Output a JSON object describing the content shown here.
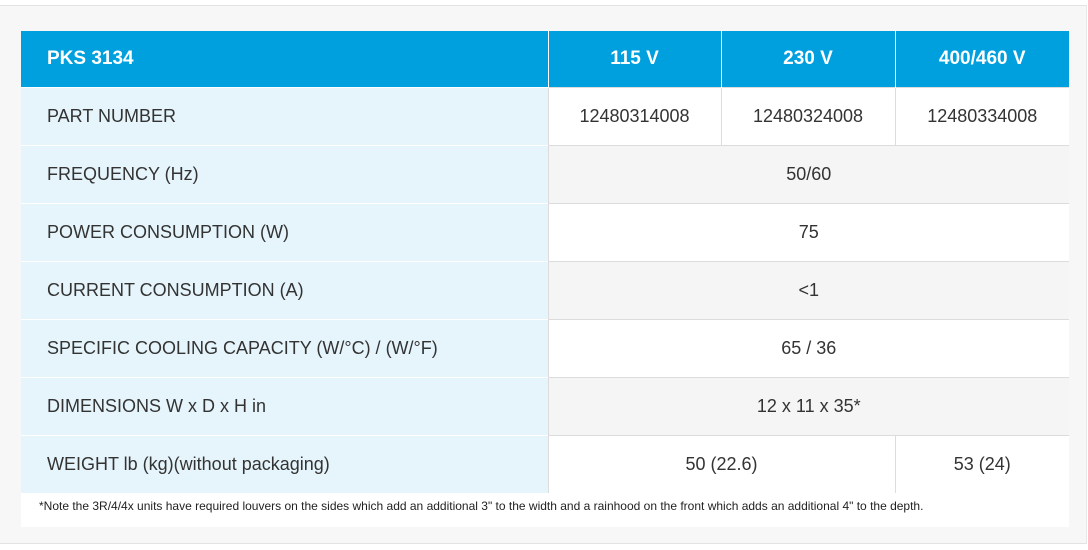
{
  "table": {
    "headers": [
      "PKS 3134",
      "115 V",
      "230 V",
      "400/460 V"
    ],
    "part_number": {
      "label": "PART NUMBER",
      "values": [
        "12480314008",
        "12480324008",
        "12480334008"
      ]
    },
    "frequency": {
      "label": "FREQUENCY (Hz)",
      "value": "50/60"
    },
    "power": {
      "label": "POWER CONSUMPTION (W)",
      "value": "75"
    },
    "current": {
      "label": "CURRENT CONSUMPTION (A)",
      "value": "<1"
    },
    "cooling": {
      "label": "SPECIFIC COOLING CAPACITY (W/°C) / (W/°F)",
      "value": "65 / 36"
    },
    "dimensions": {
      "label": "DIMENSIONS W x D x H in",
      "value": "12 x 11 x 35*"
    },
    "weight": {
      "label": "WEIGHT lb (kg)(without packaging)",
      "value_115_230": "50 (22.6)",
      "value_400_460": "53 (24)"
    }
  },
  "note": "*Note the 3R/4/4x units have required louvers on the sides which add an additional 3\" to the width and a rainhood on the front which adds an additional 4\" to the depth.",
  "colors": {
    "header_bg": "#00a0df",
    "label_bg": "#e6f5fc"
  }
}
